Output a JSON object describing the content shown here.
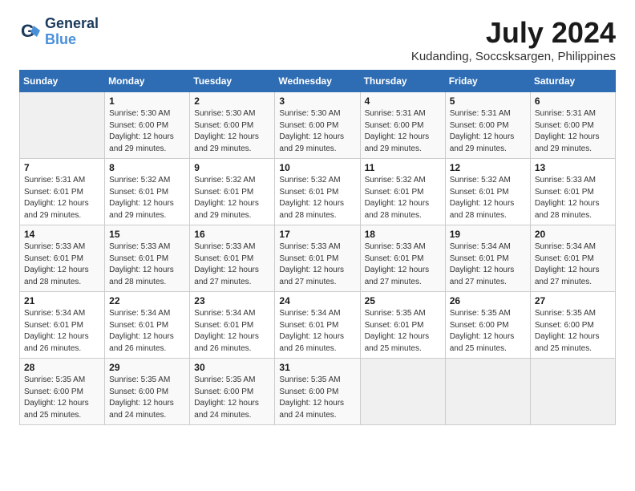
{
  "logo": {
    "line1": "General",
    "line2": "Blue"
  },
  "title": "July 2024",
  "subtitle": "Kudanding, Soccsksargen, Philippines",
  "weekdays": [
    "Sunday",
    "Monday",
    "Tuesday",
    "Wednesday",
    "Thursday",
    "Friday",
    "Saturday"
  ],
  "weeks": [
    [
      {
        "day": "",
        "detail": ""
      },
      {
        "day": "1",
        "detail": "Sunrise: 5:30 AM\nSunset: 6:00 PM\nDaylight: 12 hours\nand 29 minutes."
      },
      {
        "day": "2",
        "detail": "Sunrise: 5:30 AM\nSunset: 6:00 PM\nDaylight: 12 hours\nand 29 minutes."
      },
      {
        "day": "3",
        "detail": "Sunrise: 5:30 AM\nSunset: 6:00 PM\nDaylight: 12 hours\nand 29 minutes."
      },
      {
        "day": "4",
        "detail": "Sunrise: 5:31 AM\nSunset: 6:00 PM\nDaylight: 12 hours\nand 29 minutes."
      },
      {
        "day": "5",
        "detail": "Sunrise: 5:31 AM\nSunset: 6:00 PM\nDaylight: 12 hours\nand 29 minutes."
      },
      {
        "day": "6",
        "detail": "Sunrise: 5:31 AM\nSunset: 6:00 PM\nDaylight: 12 hours\nand 29 minutes."
      }
    ],
    [
      {
        "day": "7",
        "detail": "Sunrise: 5:31 AM\nSunset: 6:01 PM\nDaylight: 12 hours\nand 29 minutes."
      },
      {
        "day": "8",
        "detail": "Sunrise: 5:32 AM\nSunset: 6:01 PM\nDaylight: 12 hours\nand 29 minutes."
      },
      {
        "day": "9",
        "detail": "Sunrise: 5:32 AM\nSunset: 6:01 PM\nDaylight: 12 hours\nand 29 minutes."
      },
      {
        "day": "10",
        "detail": "Sunrise: 5:32 AM\nSunset: 6:01 PM\nDaylight: 12 hours\nand 28 minutes."
      },
      {
        "day": "11",
        "detail": "Sunrise: 5:32 AM\nSunset: 6:01 PM\nDaylight: 12 hours\nand 28 minutes."
      },
      {
        "day": "12",
        "detail": "Sunrise: 5:32 AM\nSunset: 6:01 PM\nDaylight: 12 hours\nand 28 minutes."
      },
      {
        "day": "13",
        "detail": "Sunrise: 5:33 AM\nSunset: 6:01 PM\nDaylight: 12 hours\nand 28 minutes."
      }
    ],
    [
      {
        "day": "14",
        "detail": "Sunrise: 5:33 AM\nSunset: 6:01 PM\nDaylight: 12 hours\nand 28 minutes."
      },
      {
        "day": "15",
        "detail": "Sunrise: 5:33 AM\nSunset: 6:01 PM\nDaylight: 12 hours\nand 28 minutes."
      },
      {
        "day": "16",
        "detail": "Sunrise: 5:33 AM\nSunset: 6:01 PM\nDaylight: 12 hours\nand 27 minutes."
      },
      {
        "day": "17",
        "detail": "Sunrise: 5:33 AM\nSunset: 6:01 PM\nDaylight: 12 hours\nand 27 minutes."
      },
      {
        "day": "18",
        "detail": "Sunrise: 5:33 AM\nSunset: 6:01 PM\nDaylight: 12 hours\nand 27 minutes."
      },
      {
        "day": "19",
        "detail": "Sunrise: 5:34 AM\nSunset: 6:01 PM\nDaylight: 12 hours\nand 27 minutes."
      },
      {
        "day": "20",
        "detail": "Sunrise: 5:34 AM\nSunset: 6:01 PM\nDaylight: 12 hours\nand 27 minutes."
      }
    ],
    [
      {
        "day": "21",
        "detail": "Sunrise: 5:34 AM\nSunset: 6:01 PM\nDaylight: 12 hours\nand 26 minutes."
      },
      {
        "day": "22",
        "detail": "Sunrise: 5:34 AM\nSunset: 6:01 PM\nDaylight: 12 hours\nand 26 minutes."
      },
      {
        "day": "23",
        "detail": "Sunrise: 5:34 AM\nSunset: 6:01 PM\nDaylight: 12 hours\nand 26 minutes."
      },
      {
        "day": "24",
        "detail": "Sunrise: 5:34 AM\nSunset: 6:01 PM\nDaylight: 12 hours\nand 26 minutes."
      },
      {
        "day": "25",
        "detail": "Sunrise: 5:35 AM\nSunset: 6:01 PM\nDaylight: 12 hours\nand 25 minutes."
      },
      {
        "day": "26",
        "detail": "Sunrise: 5:35 AM\nSunset: 6:00 PM\nDaylight: 12 hours\nand 25 minutes."
      },
      {
        "day": "27",
        "detail": "Sunrise: 5:35 AM\nSunset: 6:00 PM\nDaylight: 12 hours\nand 25 minutes."
      }
    ],
    [
      {
        "day": "28",
        "detail": "Sunrise: 5:35 AM\nSunset: 6:00 PM\nDaylight: 12 hours\nand 25 minutes."
      },
      {
        "day": "29",
        "detail": "Sunrise: 5:35 AM\nSunset: 6:00 PM\nDaylight: 12 hours\nand 24 minutes."
      },
      {
        "day": "30",
        "detail": "Sunrise: 5:35 AM\nSunset: 6:00 PM\nDaylight: 12 hours\nand 24 minutes."
      },
      {
        "day": "31",
        "detail": "Sunrise: 5:35 AM\nSunset: 6:00 PM\nDaylight: 12 hours\nand 24 minutes."
      },
      {
        "day": "",
        "detail": ""
      },
      {
        "day": "",
        "detail": ""
      },
      {
        "day": "",
        "detail": ""
      }
    ]
  ]
}
